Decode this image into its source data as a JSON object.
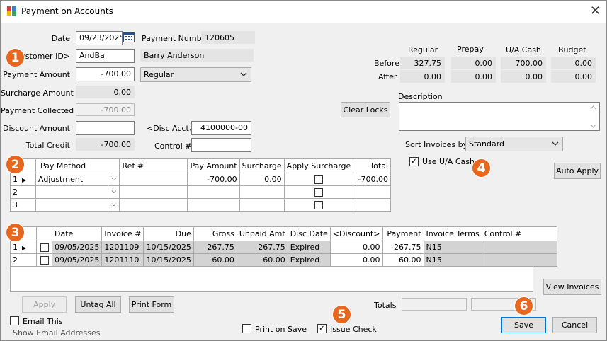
{
  "window": {
    "title": "Payment on Accounts",
    "close_glyph": "✕"
  },
  "form": {
    "date_label": "Date",
    "date_value": "09/23/2025",
    "payment_number_label": "Payment Number",
    "payment_number_value": "120605",
    "customer_id_label": "Customer ID>",
    "customer_id_value": "AndBa",
    "customer_name": "Barry Anderson",
    "payment_amount_label": "Payment Amount",
    "payment_amount_value": "-700.00",
    "payment_type": "Regular",
    "surcharge_amount_label": "Surcharge Amount",
    "surcharge_amount_value": "0.00",
    "payment_collected_label": "Payment Collected",
    "payment_collected_value": "-700.00",
    "discount_amount_label": "Discount Amount",
    "discount_amount_value": "",
    "disc_acct_label": "<Disc Acct>",
    "disc_acct_value": "4100000-00",
    "total_credit_label": "Total Credit",
    "total_credit_value": "-700.00",
    "control_label": "Control #",
    "control_value": "",
    "clear_locks_label": "Clear Locks"
  },
  "balances": {
    "headers": [
      "Regular",
      "Prepay",
      "U/A Cash",
      "Budget"
    ],
    "before_label": "Before",
    "after_label": "After",
    "before": [
      "327.75",
      "0.00",
      "700.00",
      "0.00"
    ],
    "after": [
      "0.00",
      "0.00",
      "0.00",
      "0.00"
    ]
  },
  "description": {
    "label": "Description",
    "value": ""
  },
  "sort": {
    "label": "Sort Invoices by",
    "value": "Standard"
  },
  "use_ua_cash": {
    "label": "Use U/A Cash",
    "checked": true,
    "mark": "✓"
  },
  "auto_apply_label": "Auto Apply",
  "badges": [
    "1",
    "2",
    "3",
    "4",
    "5",
    "6"
  ],
  "pay_grid": {
    "headers": [
      "Pay Method",
      "Ref #",
      "Pay Amount",
      "Surcharge",
      "Apply Surcharge",
      "Total"
    ],
    "rows": [
      {
        "num": "1",
        "method": "Adjustment",
        "ref": "",
        "amount": "-700.00",
        "surcharge": "0.00",
        "total": "-700.00"
      },
      {
        "num": "2",
        "method": "",
        "ref": "",
        "amount": "",
        "surcharge": "",
        "total": ""
      },
      {
        "num": "3",
        "method": "",
        "ref": "",
        "amount": "",
        "surcharge": "",
        "total": ""
      }
    ]
  },
  "invoice_grid": {
    "headers": [
      "Date",
      "Invoice #",
      "Due",
      "Gross",
      "Unpaid Amt",
      "Disc Date",
      "<Discount>",
      "Payment",
      "Invoice Terms",
      "Control #"
    ],
    "rows": [
      {
        "num": "1",
        "date": "09/05/2025",
        "invoice": "1201109",
        "due": "10/15/2025",
        "gross": "267.75",
        "unpaid": "267.75",
        "disc_date": "Expired",
        "discount": "0.00",
        "payment": "267.75",
        "terms": "N15",
        "control": ""
      },
      {
        "num": "2",
        "date": "09/05/2025",
        "invoice": "1201110",
        "due": "10/15/2025",
        "gross": "60.00",
        "unpaid": "60.00",
        "disc_date": "Expired",
        "discount": "0.00",
        "payment": "60.00",
        "terms": "N15",
        "control": ""
      }
    ]
  },
  "buttons": {
    "view_invoices": "View Invoices",
    "apply": "Apply",
    "untag_all": "Untag All",
    "print_form": "Print Form",
    "save": "Save",
    "cancel": "Cancel"
  },
  "totals_label": "Totals",
  "email_this": {
    "label": "Email This",
    "checked": false
  },
  "show_email_addresses": "Show Email Addresses",
  "print_on_save": {
    "label": "Print on Save",
    "checked": false
  },
  "issue_check": {
    "label": "Issue Check",
    "checked": true,
    "mark": "✓"
  },
  "colors": {
    "badge": "#e8671f",
    "grid_row_gray": "#d3d3d3",
    "window_bg": "#f0f0f0"
  }
}
